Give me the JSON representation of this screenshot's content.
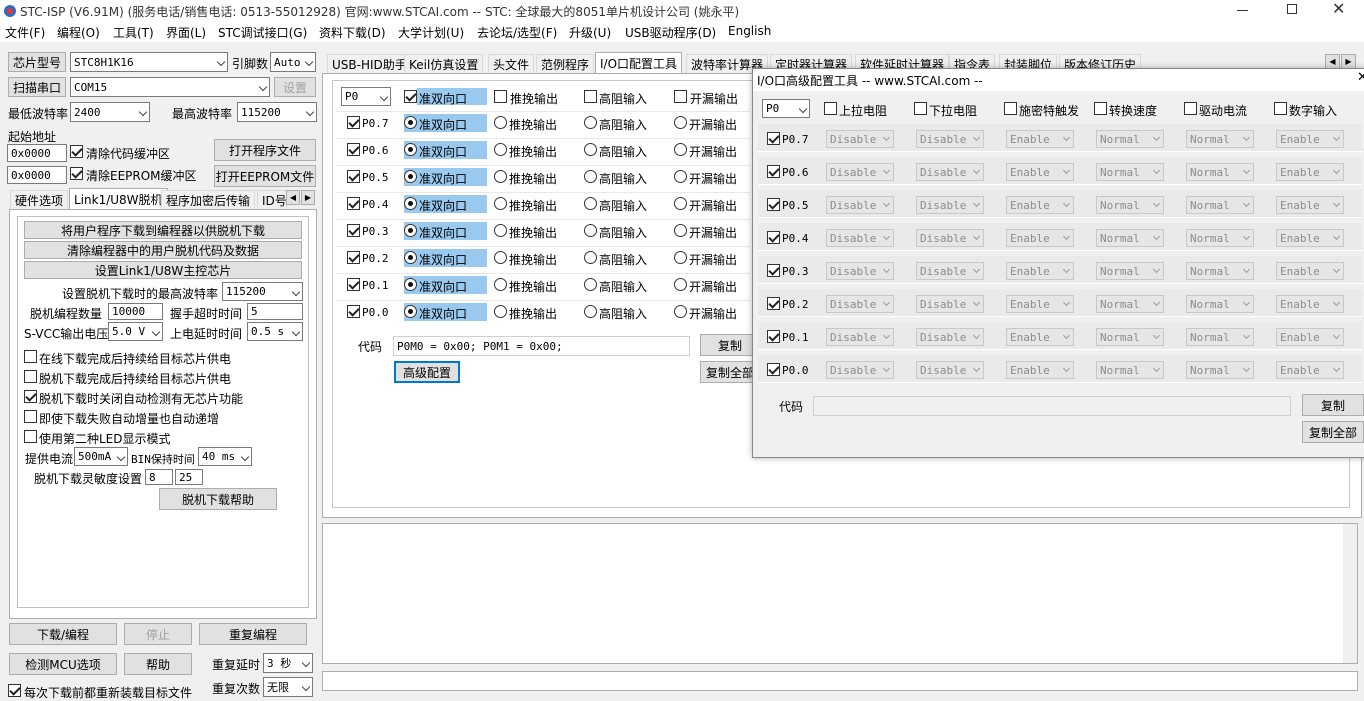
{
  "title": "STC-ISP (V6.91M) (服务电话/销售电话: 0513-55012928) 官网:www.STCAI.com  -- STC: 全球最大的8051单片机设计公司 (姚永平)",
  "menu": [
    "文件(F)",
    "编程(O)",
    "工具(T)",
    "界面(L)",
    "STC调试接口(G)",
    "资料下载(D)",
    "大学计划(U)",
    "去论坛/选型(F)",
    "升级(U)",
    "USB驱动程序(D)",
    "English"
  ],
  "left": {
    "chip_btn": "芯片型号",
    "chip_val": "STC8H1K16",
    "pins_label": "引脚数",
    "pins_val": "Auto",
    "scan_btn": "扫描串口",
    "port_val": "COM15",
    "settings_btn": "设置",
    "min_baud_label": "最低波特率",
    "min_baud_val": "2400",
    "max_baud_label": "最高波特率",
    "max_baud_val": "115200",
    "start_addr_label": "起始地址",
    "addr1": "0x0000",
    "clear_code": "清除代码缓冲区",
    "open_prog": "打开程序文件",
    "addr2": "0x0000",
    "clear_eeprom": "清除EEPROM缓冲区",
    "open_eeprom": "打开EEPROM文件",
    "tabs": [
      "硬件选项",
      "Link1/U8W脱机",
      "程序加密后传输",
      "ID号"
    ],
    "offline_btn1": "将用户程序下载到编程器以供脱机下载",
    "offline_btn2": "清除编程器中的用户脱机代码及数据",
    "offline_btn3": "设置Link1/U8W主控芯片",
    "max_baud_offline_label": "设置脱机下载时的最高波特率",
    "max_baud_offline_val": "115200",
    "count_label": "脱机编程数量",
    "count_val": "10000",
    "handshake_label": "握手超时时间",
    "handshake_val": "5",
    "svcc_label": "S-VCC输出电压",
    "svcc_val": "5.0 V",
    "power_delay_label": "上电延时时间",
    "power_delay_val": "0.5 s",
    "opts": [
      {
        "label": "在线下载完成后持续给目标芯片供电",
        "checked": false
      },
      {
        "label": "脱机下载完成后持续给目标芯片供电",
        "checked": false
      },
      {
        "label": "脱机下载时关闭自动检测有无芯片功能",
        "checked": true
      },
      {
        "label": "即使下载失败自动增量也自动递增",
        "checked": false
      },
      {
        "label": "使用第二种LED显示模式",
        "checked": false
      }
    ],
    "current_label": "提供电流",
    "current_val": "500mA",
    "bin_label": "BIN保持时间",
    "bin_val": "40 ms",
    "sens_label": "脱机下载灵敏度设置",
    "sens1": "8",
    "sens2": "25",
    "help_offline": "脱机下载帮助",
    "download_btn": "下载/编程",
    "stop_btn": "停止",
    "reprog_btn": "重复编程",
    "detect_btn": "检测MCU选项",
    "help_btn": "帮助",
    "repeat_delay_label": "重复延时",
    "repeat_delay_val": "3 秒",
    "reload_label": "每次下载前都重新装载目标文件",
    "repeat_count_label": "重复次数",
    "repeat_count_val": "无限"
  },
  "main_tabs": [
    "USB-HID助手",
    "Keil仿真设置",
    "头文件",
    "范例程序",
    "I/O口配置工具",
    "波特率计算器",
    "定时器计算器",
    "软件延时计算器",
    "指令表",
    "封装脚位",
    "版本修订历史"
  ],
  "io": {
    "port_val": "P0",
    "modes": [
      "准双向口",
      "推挽输出",
      "高阻输入",
      "开漏输出"
    ],
    "pins": [
      "P0.7",
      "P0.6",
      "P0.5",
      "P0.4",
      "P0.3",
      "P0.2",
      "P0.1",
      "P0.0"
    ],
    "code_label": "代码",
    "code_val": "P0M0 = 0x00; P0M1 = 0x00;",
    "copy_btn": "复制",
    "copy_all_btn": "复制全部",
    "adv_btn": "高级配置"
  },
  "adv": {
    "title": "I/O口高级配置工具 -- www.STCAI.com --",
    "port_val": "P0",
    "headers": [
      "上拉电阻",
      "下拉电阻",
      "施密特触发",
      "转换速度",
      "驱动电流",
      "数字输入"
    ],
    "pins": [
      "P0.7",
      "P0.6",
      "P0.5",
      "P0.4",
      "P0.3",
      "P0.2",
      "P0.1",
      "P0.0"
    ],
    "row_vals": [
      "Disable",
      "Disable",
      "Enable",
      "Normal",
      "Normal",
      "Enable"
    ],
    "code_label": "代码",
    "code_val": "",
    "copy_btn": "复制",
    "copy_all_btn": "复制全部"
  }
}
